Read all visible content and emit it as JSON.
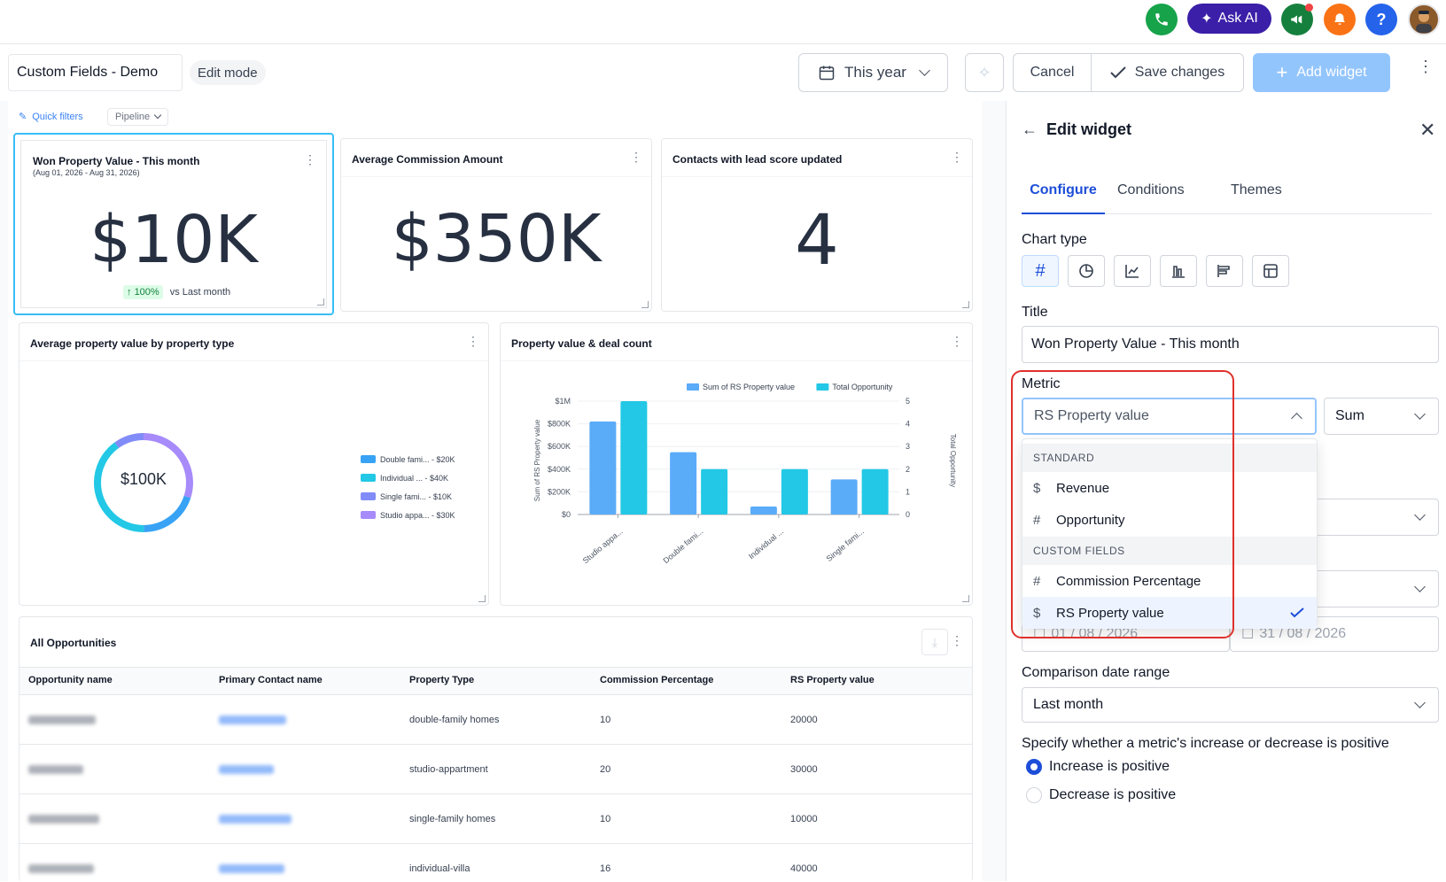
{
  "topbar": {
    "ask_ai_label": "Ask AI",
    "icons": [
      "phone-icon",
      "sparkle-icon",
      "megaphone-icon",
      "bell-icon",
      "help-icon",
      "avatar"
    ],
    "colors": {
      "phone": "#16a34a",
      "ask_ai": "#3b1fa8",
      "megaphone": "#15803d",
      "bell": "#f97316",
      "help": "#2563eb"
    }
  },
  "toolbar": {
    "dashboard_name": "Custom Fields - Demo",
    "mode_badge": "Edit mode",
    "date_range": "This year",
    "cancel_label": "Cancel",
    "save_label": "Save changes",
    "add_widget_label": "Add widget"
  },
  "filters": {
    "quick_filters": "Quick filters",
    "pipeline": "Pipeline"
  },
  "widgets": {
    "won": {
      "title": "Won Property Value - This month",
      "subtitle": "(Aug 01, 2026 - Aug 31, 2026)",
      "value": "$10K",
      "change": "100%",
      "change_label": "vs Last month"
    },
    "commission": {
      "title": "Average Commission Amount",
      "value": "$350K"
    },
    "contacts": {
      "title": "Contacts with lead score updated",
      "value": "4"
    },
    "donut": {
      "title": "Average property value by property type",
      "center_value": "$100K",
      "legend": [
        {
          "label": "Double fami... - $20K",
          "color": "#38a3f5"
        },
        {
          "label": "Individual ... - $40K",
          "color": "#22c8e5"
        },
        {
          "label": "Single fami... - $10K",
          "color": "#818cf8"
        },
        {
          "label": "Studio appa... - $30K",
          "color": "#a78bfa"
        }
      ]
    },
    "bar_title": "Property value & deal count"
  },
  "chart_data": {
    "type": "bar",
    "title": "Property value & deal count",
    "categories": [
      "Studio appa...",
      "Double fami...",
      "Individual ...",
      "Single fami..."
    ],
    "series": [
      {
        "name": "Sum of RS Property value",
        "axis": "left",
        "values": [
          820000,
          550000,
          70000,
          310000
        ],
        "color": "#5aabf8"
      },
      {
        "name": "Total Opportunity",
        "axis": "right",
        "values": [
          5,
          2,
          2,
          2
        ],
        "color": "#22c8e5"
      }
    ],
    "ylabel": "Sum of RS Property value",
    "y2label": "Total Opportunity",
    "yticks": [
      "$0",
      "$200K",
      "$400K",
      "$600K",
      "$800K",
      "$1M"
    ],
    "y2ticks": [
      "0",
      "1",
      "2",
      "3",
      "4",
      "5"
    ],
    "ylim": [
      0,
      1000000
    ],
    "y2lim": [
      0,
      5
    ],
    "legend_position": "top"
  },
  "table": {
    "title": "All Opportunities",
    "columns": [
      "Opportunity name",
      "Primary Contact name",
      "Property Type",
      "Commission Percentage",
      "RS Property value"
    ],
    "rows": [
      {
        "property_type": "double-family homes",
        "commission": "10",
        "value": "20000"
      },
      {
        "property_type": "studio-appartment",
        "commission": "20",
        "value": "30000"
      },
      {
        "property_type": "single-family homes",
        "commission": "10",
        "value": "10000"
      },
      {
        "property_type": "individual-villa",
        "commission": "16",
        "value": "40000"
      }
    ]
  },
  "panel": {
    "header": "Edit widget",
    "tabs": [
      "Configure",
      "Conditions",
      "Themes"
    ],
    "chart_type_label": "Chart type",
    "title_label": "Title",
    "title_value": "Won Property Value - This month",
    "metric_label": "Metric",
    "metric_value": "RS Property value",
    "aggregation": "Sum",
    "dropdown": {
      "section_standard": "STANDARD",
      "section_custom": "CUSTOM FIELDS",
      "items": [
        {
          "label": "Revenue",
          "icon": "dollar-icon"
        },
        {
          "label": "Opportunity",
          "icon": "hash-icon"
        },
        {
          "label": "Commission Percentage",
          "icon": "hash-icon"
        },
        {
          "label": "RS Property value",
          "icon": "dollar-icon",
          "selected": true
        }
      ]
    },
    "date_start": "01 / 08 / 2026",
    "date_end": "31 / 08 / 2026",
    "comparison_label": "Comparison date range",
    "comparison_value": "Last month",
    "specify_label": "Specify whether a metric's increase or decrease is positive",
    "radio_increase": "Increase is positive",
    "radio_decrease": "Decrease is positive"
  }
}
